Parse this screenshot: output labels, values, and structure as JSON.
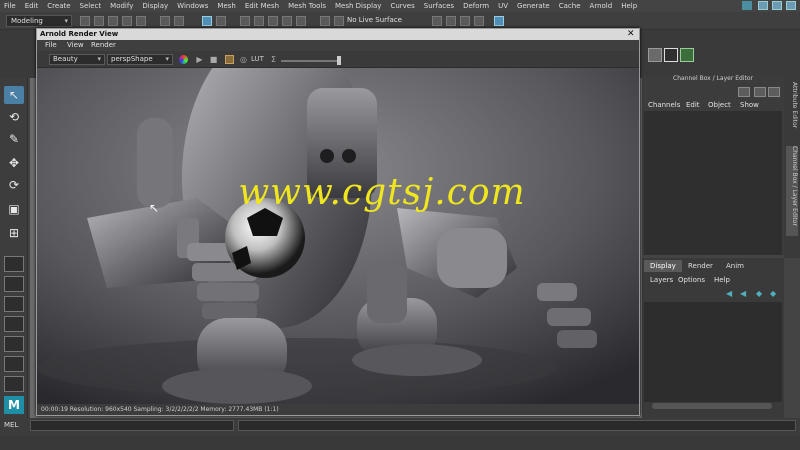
{
  "menu": [
    "File",
    "Edit",
    "Create",
    "Select",
    "Modify",
    "Display",
    "Windows",
    "Mesh",
    "Edit Mesh",
    "Mesh Tools",
    "Mesh Display",
    "Curves",
    "Surfaces",
    "Deform",
    "UV",
    "Generate",
    "Cache",
    "Arnold",
    "Help"
  ],
  "status": {
    "mode": "Modeling",
    "live_surface": "No Live Surface"
  },
  "render_view": {
    "title": "Arnold Render View",
    "menu": [
      "File",
      "View",
      "Render"
    ],
    "aov": "Beauty",
    "camera": "perspShape",
    "lut_label": "LUT",
    "status_text": "00:00:19  Resolution: 960x540  Sampling: 3/2/2/2/2/2 Memory: 2777.43MB (1:1)",
    "watermark": "www.cgtsj.com"
  },
  "channel_box": {
    "title": "Channel Box / Layer Editor",
    "menu": [
      "Channels",
      "Edit",
      "Object",
      "Show"
    ]
  },
  "layer_editor": {
    "tabs": [
      "Display",
      "Render",
      "Anim"
    ],
    "active_tab": "Display",
    "menu": [
      "Layers",
      "Options",
      "Help"
    ]
  },
  "side_tabs": [
    "Attribute Editor",
    "Channel Box / Layer Editor"
  ],
  "command_line": {
    "label": "MEL"
  }
}
